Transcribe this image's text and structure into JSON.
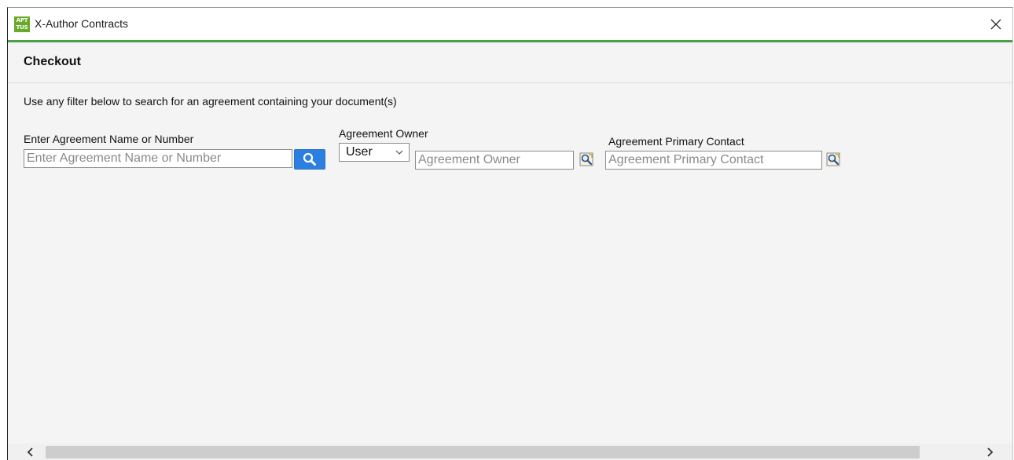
{
  "window": {
    "logo_line1": "APT",
    "logo_line2": "TUS",
    "title": "X-Author Contracts"
  },
  "header": {
    "title": "Checkout"
  },
  "instructions": "Use any filter below to search for an agreement containing your document(s)",
  "filters": {
    "name": {
      "label": "Enter Agreement Name or Number",
      "placeholder": "Enter Agreement Name or Number",
      "value": ""
    },
    "owner": {
      "label": "Agreement Owner",
      "type_selected": "User",
      "placeholder": "Agreement Owner",
      "value": ""
    },
    "contact": {
      "label": "Agreement Primary Contact",
      "placeholder": "Agreement Primary Contact",
      "value": ""
    }
  },
  "colors": {
    "accent": "#4aa04a",
    "search_button": "#2b7fe0",
    "logo": "#6aaa2a"
  },
  "icons": {
    "close": "close-icon",
    "search": "search-icon",
    "lookup": "lookup-icon",
    "dropdown": "chevron-down-icon",
    "scroll_left": "chevron-left-icon",
    "scroll_right": "chevron-right-icon"
  }
}
